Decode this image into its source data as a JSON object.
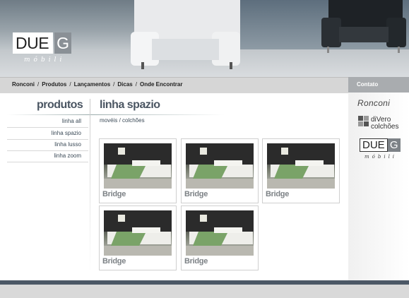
{
  "header": {
    "logo_main": "DUE",
    "logo_letter": "G",
    "logo_sub": "móbili"
  },
  "nav": {
    "items": [
      "Ronconi",
      "Produtos",
      "Lançamentos",
      "Dicas",
      "Onde Encontrar"
    ],
    "separator": "/",
    "contact": "Contato"
  },
  "sidebar": {
    "title": "produtos",
    "items": [
      {
        "label": "linha all"
      },
      {
        "label": "linha spazio"
      },
      {
        "label": "linha lusso"
      },
      {
        "label": "linha zoom"
      }
    ]
  },
  "main": {
    "title": "linha spazio",
    "breadcrumb": "movéis / colchões",
    "products": [
      {
        "label": "Bridge"
      },
      {
        "label": "Bridge"
      },
      {
        "label": "Bridge"
      },
      {
        "label": "Bridge"
      },
      {
        "label": "Bridge"
      }
    ]
  },
  "partners": {
    "ronconi": "Ronconi",
    "divero_line1": "diVero",
    "divero_line2": "colchões",
    "due_main": "DUE",
    "due_letter": "G",
    "due_sub": "móbili"
  }
}
